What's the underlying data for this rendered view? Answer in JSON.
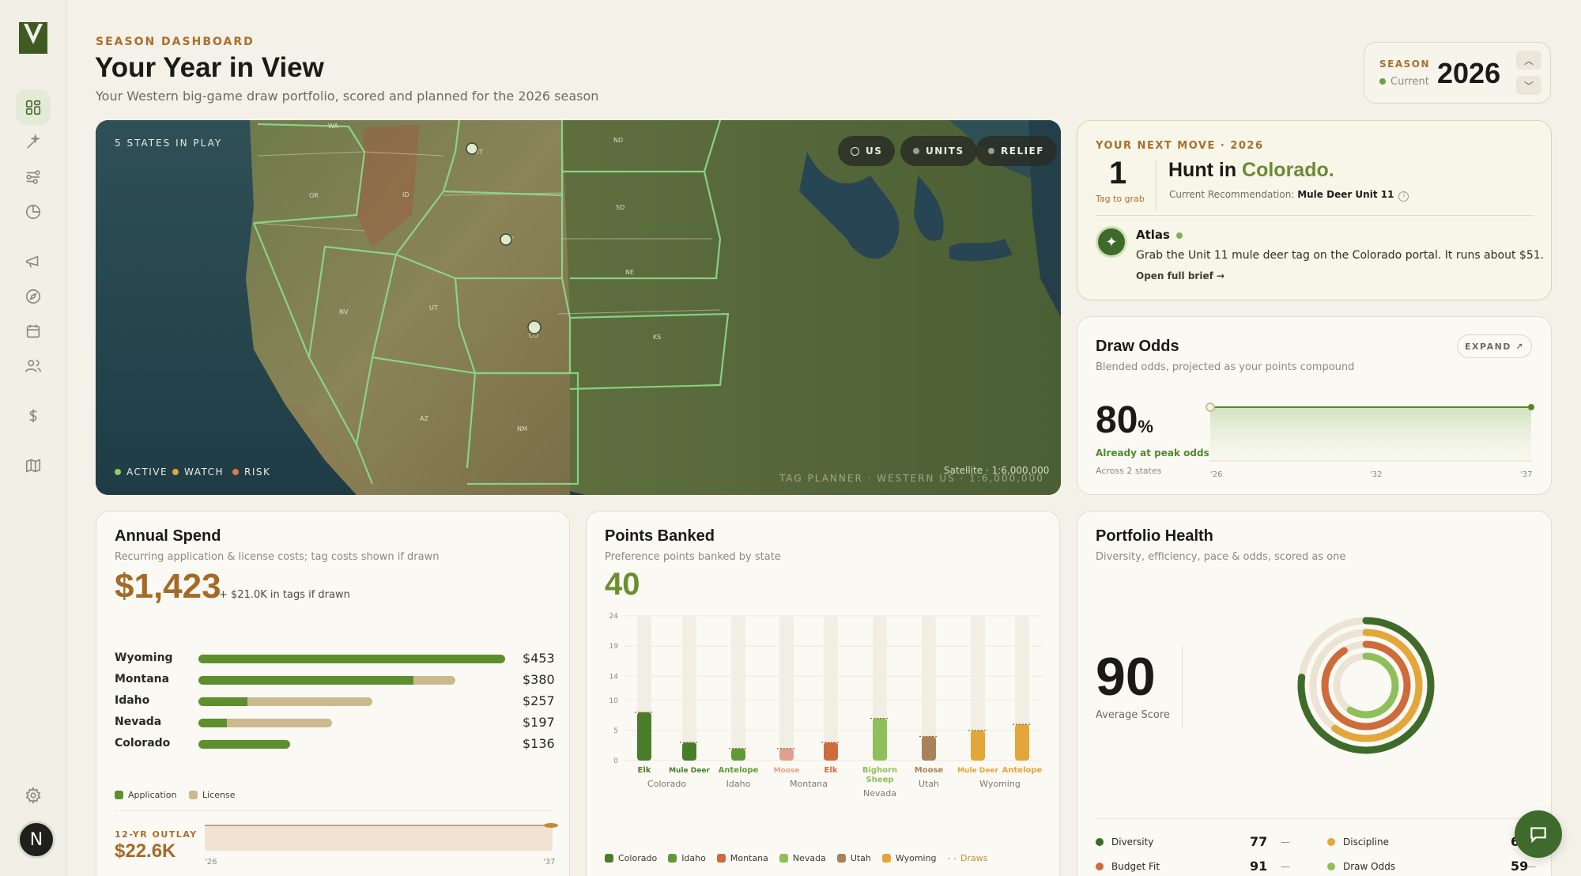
{
  "header": {
    "eyebrow": "SEASON DASHBOARD",
    "title": "Your Year in View",
    "subtitle": "Your Western big-game draw portfolio, scored and planned for the 2026 season"
  },
  "season": {
    "label": "SEASON",
    "status": "Current",
    "year": "2026"
  },
  "sidebar": {
    "items": [
      "dashboard",
      "strategy",
      "planner",
      "portfolio",
      "applications",
      "explore",
      "calendar",
      "group",
      "finance",
      "map"
    ],
    "avatar_initial": "N"
  },
  "map": {
    "label": "5 STATES IN PLAY",
    "toggles": [
      "US",
      "UNITS",
      "RELIEF"
    ],
    "legend": [
      {
        "label": "ACTIVE",
        "color": "#8fcf5f"
      },
      {
        "label": "WATCH",
        "color": "#e8a23c"
      },
      {
        "label": "RISK",
        "color": "#e07a4a"
      }
    ],
    "attribution": "Satellite · 1:6,000,000",
    "footer": "TAG PLANNER · WESTERN US · 1:6,000,000",
    "state_labels": [
      "WA",
      "OR",
      "ID",
      "NV",
      "UT",
      "AZ",
      "NM",
      "MT",
      "WY",
      "CO",
      "ND",
      "SD",
      "NE",
      "KS"
    ]
  },
  "next_move": {
    "eyebrow": "YOUR NEXT MOVE · 2026",
    "count": "1",
    "count_label": "Tag to grab",
    "title_prefix": "Hunt in ",
    "title_state": "Colorado.",
    "rec_label": "Current Recommendation: ",
    "rec_value": "Mule Deer Unit 11",
    "atlas_name": "Atlas",
    "atlas_message": "Grab the Unit 11 mule deer tag on the Colorado portal. It runs about $51.",
    "atlas_link": "Open full brief →"
  },
  "draw_odds": {
    "title": "Draw Odds",
    "subtitle": "Blended odds, projected as your points compound",
    "expand_label": "EXPAND ↗",
    "value": "80",
    "unit": "%",
    "peak_label": "Already at peak odds",
    "across_label": "Across 2 states",
    "x_ticks": [
      "'26",
      "'32",
      "'37"
    ]
  },
  "annual_spend": {
    "title": "Annual Spend",
    "subtitle": "Recurring application & license costs; tag costs shown if drawn",
    "total": "$1,423",
    "tags_note": "+ $21.0K in tags if drawn",
    "rows": [
      {
        "state": "Wyoming",
        "application": 453,
        "license": 0,
        "value": "$453"
      },
      {
        "state": "Montana",
        "application": 318,
        "license": 62,
        "value": "$380"
      },
      {
        "state": "Idaho",
        "application": 72,
        "license": 185,
        "value": "$257"
      },
      {
        "state": "Nevada",
        "application": 42,
        "license": 155,
        "value": "$197"
      },
      {
        "state": "Colorado",
        "application": 136,
        "license": 0,
        "value": "$136"
      }
    ],
    "legend": [
      {
        "label": "Application",
        "color": "#5e8f2f"
      },
      {
        "label": "License",
        "color": "#cdb98e"
      }
    ],
    "outlay_label": "12-YR OUTLAY",
    "outlay_value": "$22.6K",
    "outlay_ticks": [
      "'26",
      "'37"
    ]
  },
  "points_banked": {
    "title": "Points Banked",
    "subtitle": "Preference points banked by state",
    "total": "40",
    "chart_data": {
      "type": "bar",
      "y_ticks": [
        0,
        5,
        10,
        14,
        19,
        24
      ],
      "ylim": [
        0,
        24
      ],
      "bars": [
        {
          "species": "Elk",
          "state": "Colorado",
          "value": 8,
          "color": "#4a7d2a"
        },
        {
          "species": "Mule Deer",
          "state": "Colorado",
          "value": 3,
          "color": "#4a7d2a"
        },
        {
          "species": "Antelope",
          "state": "Idaho",
          "value": 2,
          "color": "#5f9a35"
        },
        {
          "species": "Moose",
          "state": "Montana",
          "value": 2,
          "color": "#e0a08c"
        },
        {
          "species": "Elk",
          "state": "Montana",
          "value": 3,
          "color": "#cf6a3a"
        },
        {
          "species": "Bighorn Sheep",
          "state": "Nevada",
          "value": 7,
          "color": "#8fbf5a"
        },
        {
          "species": "Moose",
          "state": "Utah",
          "value": 4,
          "color": "#a9825a"
        },
        {
          "species": "Mule Deer",
          "state": "Wyoming",
          "value": 5,
          "color": "#e3a63a"
        },
        {
          "species": "Antelope",
          "state": "Wyoming",
          "value": 6,
          "color": "#e3a63a"
        }
      ],
      "state_groups": [
        "Colorado",
        "Idaho",
        "Montana",
        "Nevada",
        "Utah",
        "Wyoming"
      ],
      "legend": [
        {
          "label": "Colorado",
          "color": "#4a7d2a"
        },
        {
          "label": "Idaho",
          "color": "#5f9a35"
        },
        {
          "label": "Montana",
          "color": "#cf6a3a"
        },
        {
          "label": "Nevada",
          "color": "#8fbf5a"
        },
        {
          "label": "Utah",
          "color": "#a9825a"
        },
        {
          "label": "Wyoming",
          "color": "#e3a63a"
        },
        {
          "label": "Draws",
          "color": "#cf8a3a"
        }
      ]
    }
  },
  "portfolio_health": {
    "title": "Portfolio Health",
    "subtitle": "Diversity, efficiency, pace & odds, scored as one",
    "score": "90",
    "score_label": "Average Score",
    "metrics": [
      {
        "label": "Diversity",
        "value": "77",
        "color": "#3f6b2a"
      },
      {
        "label": "Discipline",
        "value": "60",
        "color": "#e3a63a"
      },
      {
        "label": "Budget Fit",
        "value": "91",
        "color": "#cf6a3a"
      },
      {
        "label": "Draw Odds",
        "value": "59",
        "color": "#8fbf5a"
      }
    ]
  }
}
